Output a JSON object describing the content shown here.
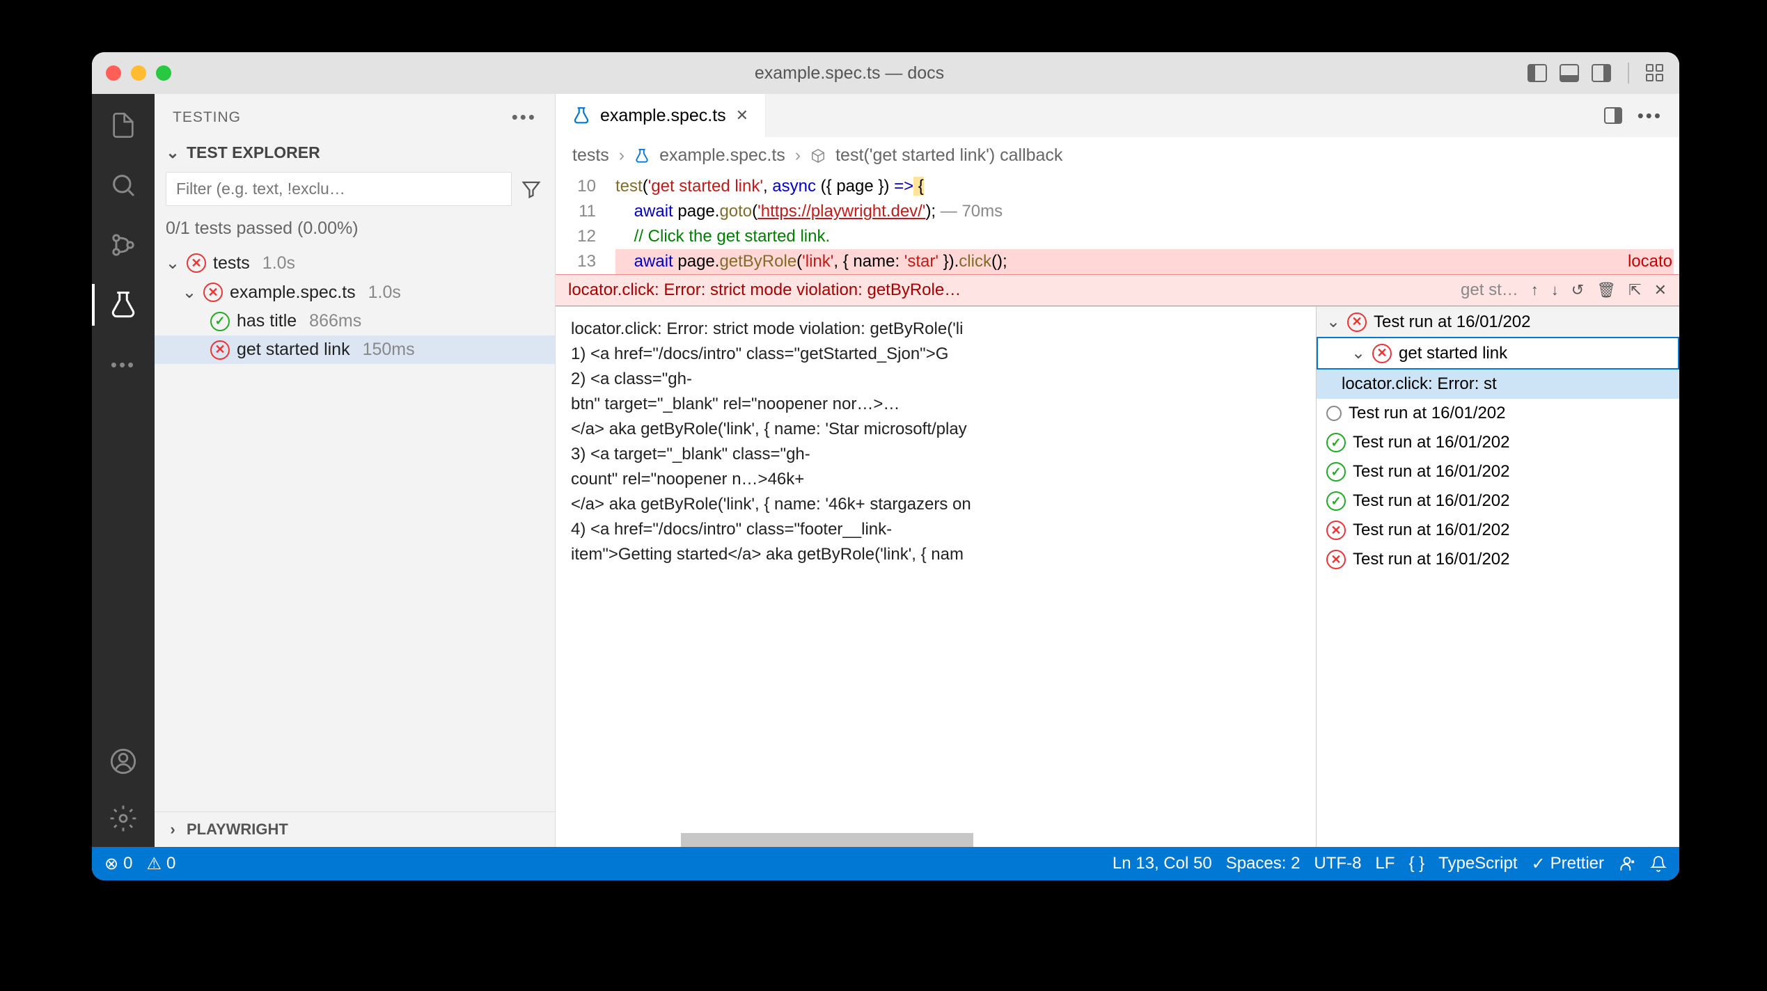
{
  "title": "example.spec.ts — docs",
  "sidebar": {
    "title": "TESTING",
    "section": "TEST EXPLORER",
    "filter_placeholder": "Filter (e.g. text, !exclu…",
    "status": "0/1 tests passed (0.00%)",
    "tree": {
      "root": {
        "name": "tests",
        "time": "1.0s"
      },
      "file": {
        "name": "example.spec.ts",
        "time": "1.0s"
      },
      "t1": {
        "name": "has title",
        "time": "866ms"
      },
      "t2": {
        "name": "get started link",
        "time": "150ms"
      }
    },
    "footer": "PLAYWRIGHT"
  },
  "tab": {
    "name": "example.spec.ts"
  },
  "breadcrumbs": {
    "a": "tests",
    "b": "example.spec.ts",
    "c": "test('get started link') callback"
  },
  "lines": {
    "l10": "10",
    "l11": "11",
    "l12": "12",
    "l13": "13"
  },
  "code": {
    "l10": {
      "a": "test",
      "b": "(",
      "c": "'get started link'",
      "d": ", ",
      "e": "async",
      "f": " ({ ",
      "g": "page",
      "h": " }) ",
      "i": "=>",
      "j": " {"
    },
    "l11": {
      "a": "    ",
      "b": "await",
      "c": " page.",
      "d": "goto",
      "e": "(",
      "f": "'https://playwright.dev/'",
      "g": ");",
      "h": " — 70ms"
    },
    "l12": {
      "a": "    ",
      "b": "// Click the get started link."
    },
    "l13": {
      "a": "    ",
      "b": "await",
      "c": " page.",
      "d": "getByRole",
      "e": "(",
      "f": "'link'",
      "g": ", { ",
      "h": "name",
      "i": ": ",
      "j": "'star'",
      "k": " }).",
      "l": "click",
      "m": "();",
      "err": "locato"
    }
  },
  "errbar": {
    "msg": "locator.click: Error: strict mode violation: getByRole…",
    "hint": "get st…"
  },
  "problems": {
    "p1": "locator.click: Error: strict mode violation: getByRole('li",
    "p2": "    1) <a href=\"/docs/intro\" class=\"getStarted_Sjon\">G",
    "p3": "    2) <a class=\"gh-",
    "p4": "btn\" target=\"_blank\" rel=\"noopener nor…>…",
    "p5": "</a> aka getByRole('link', { name: 'Star microsoft/play",
    "p6": "    3) <a target=\"_blank\" class=\"gh-",
    "p7": "count\" rel=\"noopener n…>46k+",
    "p8": "</a> aka getByRole('link', { name: '46k+ stargazers on",
    "p9": "    4) <a href=\"/docs/intro\" class=\"footer__link-",
    "p10": "item\">Getting started</a> aka getByRole('link', { nam"
  },
  "runs": {
    "head": "Test run at 16/01/202",
    "sel": "get started link",
    "sub": "locator.click: Error: st",
    "r1": "Test run at 16/01/202",
    "r2": "Test run at 16/01/202",
    "r3": "Test run at 16/01/202",
    "r4": "Test run at 16/01/202",
    "r5": "Test run at 16/01/202",
    "r6": "Test run at 16/01/202"
  },
  "status": {
    "errors": "0",
    "warnings": "0",
    "pos": "Ln 13, Col 50",
    "spaces": "Spaces: 2",
    "enc": "UTF-8",
    "eol": "LF",
    "lang": "TypeScript",
    "fmt": "Prettier"
  }
}
